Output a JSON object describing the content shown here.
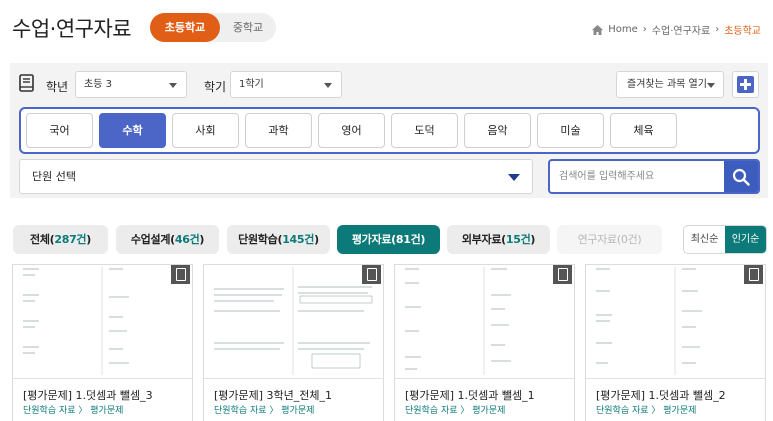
{
  "header": {
    "title": "수업·연구자료",
    "level_active": "초등학교",
    "level_other": "중학교",
    "breadcrumb": [
      "Home",
      "수업·연구자료",
      "초등학교"
    ]
  },
  "filters": {
    "grade_label": "학년",
    "grade_value": "초등 3",
    "semester_label": "학기",
    "semester_value": "1학기",
    "favorites_label": "즐겨찾는 과목 열기",
    "unit_select": "단원 선택",
    "search_placeholder": "검색어를 입력해주세요"
  },
  "subjects": [
    "국어",
    "수학",
    "사회",
    "과학",
    "영어",
    "도덕",
    "음악",
    "미술",
    "체육"
  ],
  "active_subject": "수학",
  "categories": [
    {
      "label": "전체",
      "count": "287건"
    },
    {
      "label": "수업설계",
      "count": "46건"
    },
    {
      "label": "단원학습",
      "count": "145건"
    },
    {
      "label": "평가자료",
      "count": "81건"
    },
    {
      "label": "외부자료",
      "count": "15건"
    },
    {
      "label": "연구자료",
      "count": "0건"
    }
  ],
  "sort": {
    "latest": "최신순",
    "popular": "인기순"
  },
  "cards": [
    {
      "title": "[평가문제] 1.덧셈과 뺄셈_3",
      "meta": "단원학습 자료 〉 평가문제"
    },
    {
      "title": "[평가문제] 3학년_전체_1",
      "meta": "단원학습 자료 〉 평가문제"
    },
    {
      "title": "[평가문제] 1.덧셈과 뺄셈_1",
      "meta": "단원학습 자료 〉 평가문제"
    },
    {
      "title": "[평가문제] 1.덧셈과 뺄셈_2",
      "meta": "단원학습 자료 〉 평가문제"
    }
  ],
  "colors": {
    "accent_orange": "#e05e16",
    "accent_blue": "#4b66c6",
    "accent_teal": "#0b7a78"
  }
}
